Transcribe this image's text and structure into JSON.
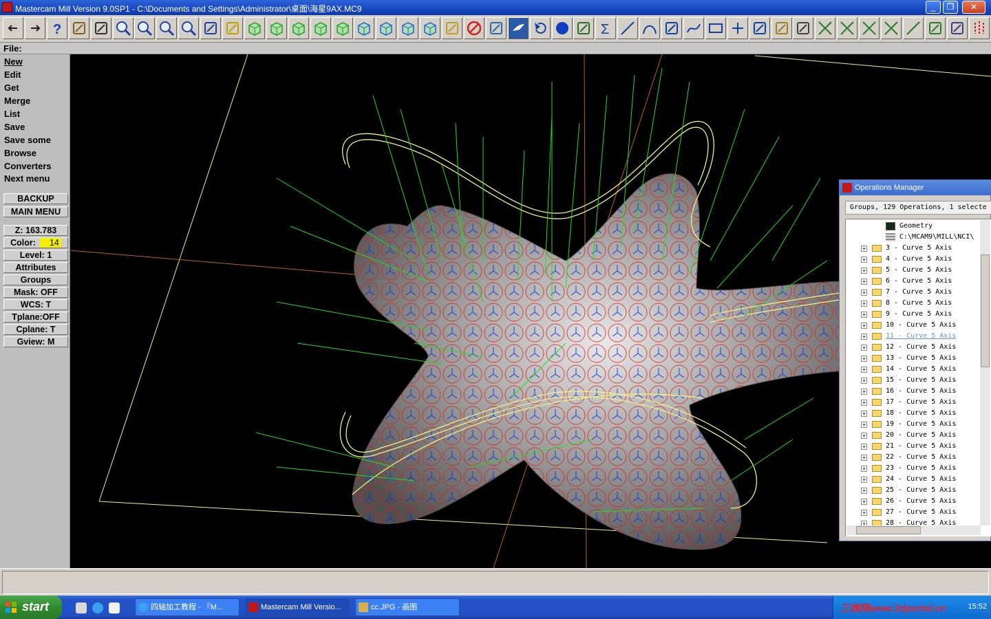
{
  "window": {
    "title": "Mastercam Mill Version 9.0SP1 - C:\\Documents and Settings\\Administrator\\桌面\\海星9AX.MC9",
    "minimize": "_",
    "maximize": "❐",
    "close": "✕"
  },
  "file_bar": {
    "label": "File:"
  },
  "menu": {
    "items": [
      {
        "label": "New"
      },
      {
        "label": "Edit"
      },
      {
        "label": "Get"
      },
      {
        "label": "Merge"
      },
      {
        "label": "List"
      },
      {
        "label": "Save"
      },
      {
        "label": "Save some"
      },
      {
        "label": "Browse"
      },
      {
        "label": "Converters"
      },
      {
        "label": "Next menu"
      }
    ],
    "backup": "BACKUP",
    "main_menu": "MAIN MENU",
    "z": "Z: 163.783",
    "color_label": "Color:",
    "color_value": "14",
    "color_swatch": "#f5f000",
    "level": "Level:  1",
    "attributes": "Attributes",
    "groups": "Groups",
    "mask": "Mask:  OFF",
    "wcs": "WCS:   T",
    "tplane": "Tplane:OFF",
    "cplane": "Cplane:  T",
    "gview": "Gview:    M"
  },
  "ops_manager": {
    "title": "Operations Manager",
    "summary": "Groups, 129 Operations, 1 selecte",
    "geometry": "Geometry",
    "nci_path": "C:\\MCAM9\\MILL\\NCI\\",
    "operations": [
      "3 - Curve 5 Axis",
      "4 - Curve 5 Axis",
      "5 - Curve 5 Axis",
      "6 - Curve 5 Axis",
      "7 - Curve 5 Axis",
      "8 - Curve 5 Axis",
      "9 - Curve 5 Axis",
      "10 - Curve 5 Axis",
      "11 - Curve 5 Axis",
      "12 - Curve 5 Axis",
      "13 - Curve 5 Axis",
      "14 - Curve 5 Axis",
      "15 - Curve 5 Axis",
      "16 - Curve 5 Axis",
      "17 - Curve 5 Axis",
      "18 - Curve 5 Axis",
      "19 - Curve 5 Axis",
      "20 - Curve 5 Axis",
      "21 - Curve 5 Axis",
      "22 - Curve 5 Axis",
      "23 - Curve 5 Axis",
      "24 - Curve 5 Axis",
      "25 - Curve 5 Axis",
      "26 - Curve 5 Axis",
      "27 - Curve 5 Axis",
      "28 - Curve 5 Axis"
    ],
    "selected_operation": "11 - Curve 5 Axis"
  },
  "taskbar": {
    "start": "start",
    "tasks": [
      {
        "label": "四轴加工教程 - 『M...",
        "icon": "ie-icon"
      },
      {
        "label": "Mastercam Mill Versio...",
        "icon": "mastercam-icon"
      },
      {
        "label": "cc.JPG - 画图",
        "icon": "paint-icon"
      }
    ],
    "watermark": "三维网www.3dportal.cn",
    "clock": "15:52"
  },
  "toolbar": {
    "icons": [
      "back-arrow-icon",
      "forward-arrow-icon",
      "help-icon",
      "calculator-icon",
      "pointer-help-icon",
      "zoom-icon",
      "zoom-window-icon",
      "zoom-unzoom-icon",
      "zoom-fit-icon",
      "pan-icon",
      "select-window-icon",
      "view-iso-icon",
      "view-top-icon",
      "view-front-icon",
      "view-side-icon",
      "view-shade-icon",
      "view-cube-1-icon",
      "view-cube-2-icon",
      "view-cube-3-icon",
      "view-cube-4-icon",
      "pencil-icon",
      "no-entry-icon",
      "toolpath-icon",
      "mastercam-logo-icon",
      "undo-icon",
      "sphere-icon",
      "transform-icon",
      "sum-icon",
      "line-icon",
      "arc-icon",
      "trim-icon",
      "spline-icon",
      "rectangle-icon",
      "point-icon",
      "surface-icon",
      "solid-icon",
      "dimension-icon",
      "cross-1-icon",
      "cross-2-icon",
      "cross-3-icon",
      "cross-4-icon",
      "diagonal-icon",
      "break-icon",
      "eraser-icon",
      "mirror-icon",
      "settings-icon"
    ],
    "active_icon": "mastercam-logo-icon"
  },
  "colors": {
    "viewport_bg": "#000000",
    "surface": "#a8a8a8",
    "toolpath_red": "#e01818",
    "vectors_green": "#22dd22",
    "curves_yellow": "#f0f088",
    "crosshair": "#c06020"
  }
}
